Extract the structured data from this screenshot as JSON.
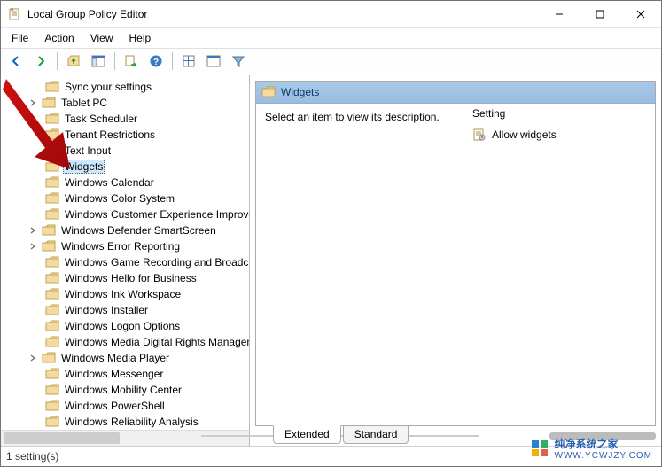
{
  "title": "Local Group Policy Editor",
  "menu": {
    "file": "File",
    "action": "Action",
    "view": "View",
    "help": "Help"
  },
  "toolbar": {
    "back": "back",
    "forward": "forward",
    "up": "up",
    "showhide": "show-hide-tree",
    "export": "export-list",
    "help": "help",
    "options1": "options",
    "options2": "options",
    "filter": "filter"
  },
  "tree": {
    "items": [
      {
        "label": "Sync your settings",
        "expandable": false,
        "selected": false
      },
      {
        "label": "Tablet PC",
        "expandable": true,
        "selected": false
      },
      {
        "label": "Task Scheduler",
        "expandable": false,
        "selected": false
      },
      {
        "label": "Tenant Restrictions",
        "expandable": false,
        "selected": false
      },
      {
        "label": "Text Input",
        "expandable": false,
        "selected": false
      },
      {
        "label": "Widgets",
        "expandable": false,
        "selected": true
      },
      {
        "label": "Windows Calendar",
        "expandable": false,
        "selected": false
      },
      {
        "label": "Windows Color System",
        "expandable": false,
        "selected": false
      },
      {
        "label": "Windows Customer Experience Improvement Program",
        "expandable": false,
        "selected": false
      },
      {
        "label": "Windows Defender SmartScreen",
        "expandable": true,
        "selected": false
      },
      {
        "label": "Windows Error Reporting",
        "expandable": true,
        "selected": false
      },
      {
        "label": "Windows Game Recording and Broadcasting",
        "expandable": false,
        "selected": false
      },
      {
        "label": "Windows Hello for Business",
        "expandable": false,
        "selected": false
      },
      {
        "label": "Windows Ink Workspace",
        "expandable": false,
        "selected": false
      },
      {
        "label": "Windows Installer",
        "expandable": false,
        "selected": false
      },
      {
        "label": "Windows Logon Options",
        "expandable": false,
        "selected": false
      },
      {
        "label": "Windows Media Digital Rights Management",
        "expandable": false,
        "selected": false
      },
      {
        "label": "Windows Media Player",
        "expandable": true,
        "selected": false
      },
      {
        "label": "Windows Messenger",
        "expandable": false,
        "selected": false
      },
      {
        "label": "Windows Mobility Center",
        "expandable": false,
        "selected": false
      },
      {
        "label": "Windows PowerShell",
        "expandable": false,
        "selected": false
      },
      {
        "label": "Windows Reliability Analysis",
        "expandable": false,
        "selected": false
      }
    ]
  },
  "detail": {
    "header": "Widgets",
    "description": "Select an item to view its description.",
    "settings_header": "Setting",
    "settings": [
      {
        "label": "Allow widgets"
      }
    ]
  },
  "tabs": {
    "extended": "Extended",
    "standard": "Standard",
    "active": "extended"
  },
  "status": "1 setting(s)",
  "watermark": {
    "main": "纯净系统之家",
    "sub": "WWW.YCWJZY.COM"
  }
}
